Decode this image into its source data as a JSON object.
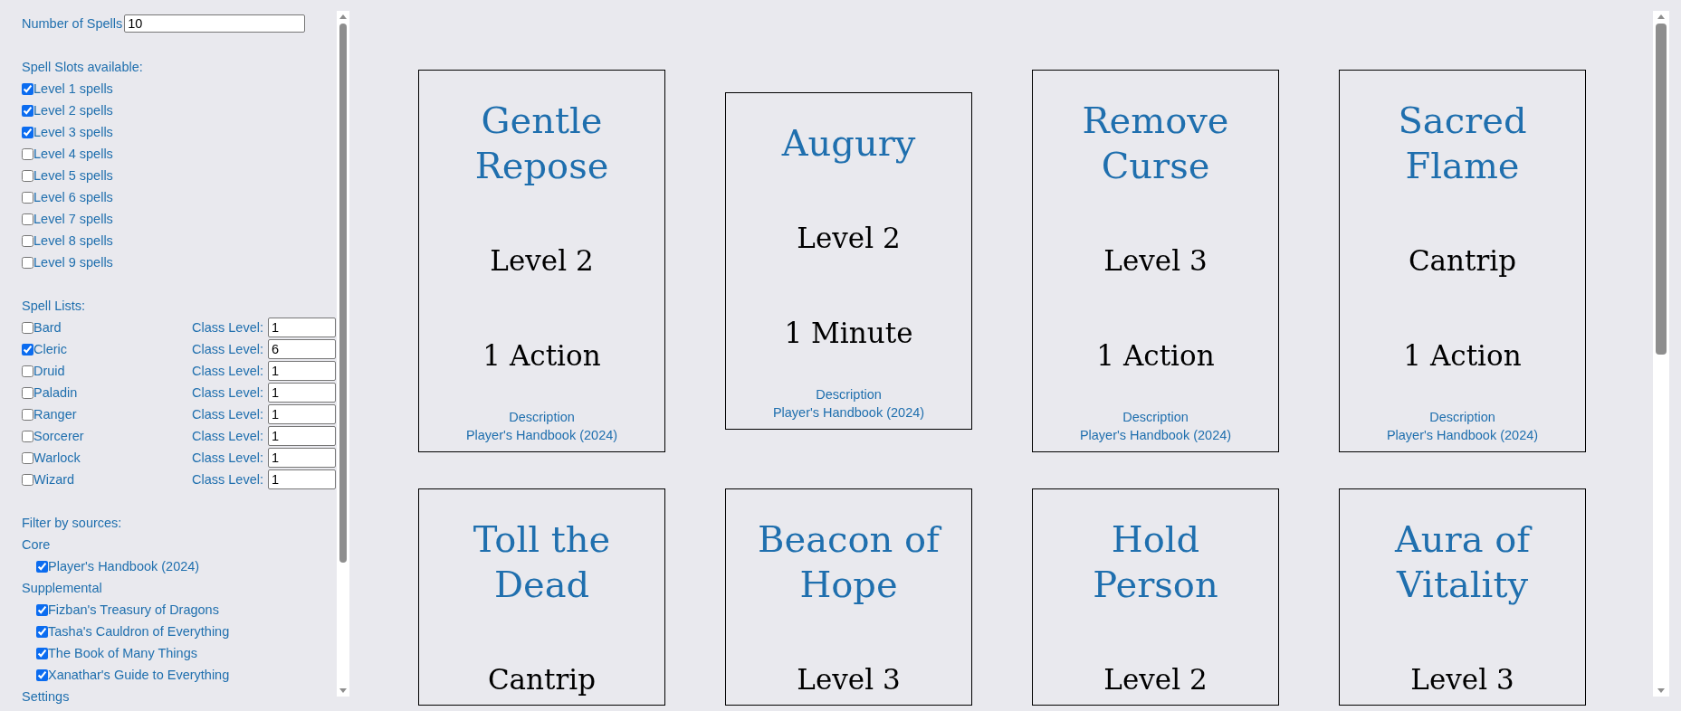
{
  "number_of_spells": {
    "label": "Number of Spells",
    "value": "10"
  },
  "spell_slots": {
    "heading": "Spell Slots available:",
    "items": [
      {
        "label": "Level 1 spells",
        "checked": true
      },
      {
        "label": "Level 2 spells",
        "checked": true
      },
      {
        "label": "Level 3 spells",
        "checked": true
      },
      {
        "label": "Level 4 spells",
        "checked": false
      },
      {
        "label": "Level 5 spells",
        "checked": false
      },
      {
        "label": "Level 6 spells",
        "checked": false
      },
      {
        "label": "Level 7 spells",
        "checked": false
      },
      {
        "label": "Level 8 spells",
        "checked": false
      },
      {
        "label": "Level 9 spells",
        "checked": false
      }
    ]
  },
  "spell_lists": {
    "heading": "Spell Lists:",
    "items": [
      {
        "label": "Bard",
        "checked": false,
        "class_level_label": "Class Level:",
        "class_level": "1"
      },
      {
        "label": "Cleric",
        "checked": true,
        "class_level_label": "Class Level:",
        "class_level": "6"
      },
      {
        "label": "Druid",
        "checked": false,
        "class_level_label": "Class Level:",
        "class_level": "1"
      },
      {
        "label": "Paladin",
        "checked": false,
        "class_level_label": "Class Level:",
        "class_level": "1"
      },
      {
        "label": "Ranger",
        "checked": false,
        "class_level_label": "Class Level:",
        "class_level": "1"
      },
      {
        "label": "Sorcerer",
        "checked": false,
        "class_level_label": "Class Level:",
        "class_level": "1"
      },
      {
        "label": "Warlock",
        "checked": false,
        "class_level_label": "Class Level:",
        "class_level": "1"
      },
      {
        "label": "Wizard",
        "checked": false,
        "class_level_label": "Class Level:",
        "class_level": "1"
      }
    ]
  },
  "sources": {
    "heading": "Filter by sources:",
    "groups": [
      {
        "name": "Core",
        "items": [
          {
            "label": "Player's Handbook (2024)",
            "checked": true
          }
        ]
      },
      {
        "name": "Supplemental",
        "items": [
          {
            "label": "Fizban's Treasury of Dragons",
            "checked": true
          },
          {
            "label": "Tasha's Cauldron of Everything",
            "checked": true
          },
          {
            "label": "The Book of Many Things",
            "checked": true
          },
          {
            "label": "Xanathar's Guide to Everything",
            "checked": true
          }
        ]
      }
    ]
  },
  "settings_heading": "Settings",
  "cards": [
    {
      "title": "Gentle Repose",
      "level": "Level 2",
      "casting_time": "1 Action",
      "link": "Description",
      "source": "Player's Handbook (2024)"
    },
    {
      "title": "Augury",
      "level": "Level 2",
      "casting_time": "1 Minute",
      "link": "Description",
      "source": "Player's Handbook (2024)"
    },
    {
      "title": "Remove Curse",
      "level": "Level 3",
      "casting_time": "1 Action",
      "link": "Description",
      "source": "Player's Handbook (2024)"
    },
    {
      "title": "Sacred Flame",
      "level": "Cantrip",
      "casting_time": "1 Action",
      "link": "Description",
      "source": "Player's Handbook (2024)"
    },
    {
      "title": "Toll the Dead",
      "level": "Cantrip"
    },
    {
      "title": "Beacon of Hope",
      "level": "Level 3"
    },
    {
      "title": "Hold Person",
      "level": "Level 2"
    },
    {
      "title": "Aura of Vitality",
      "level": "Level 3"
    }
  ]
}
